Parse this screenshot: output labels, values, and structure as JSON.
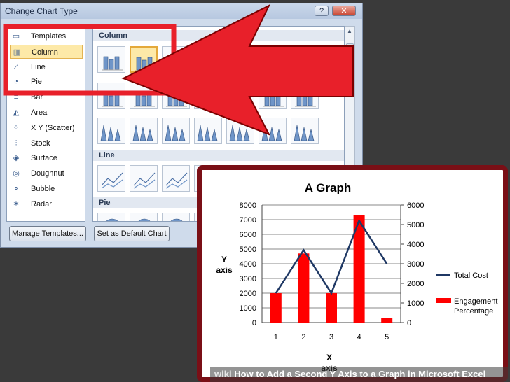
{
  "dialog": {
    "title": "Change Chart Type",
    "help_glyph": "?",
    "close_glyph": "✕",
    "categories": [
      {
        "label": "Templates",
        "icon": "folder-icon",
        "glyph": "▭"
      },
      {
        "label": "Column",
        "icon": "column-chart-icon",
        "glyph": "▥",
        "selected": true
      },
      {
        "label": "Line",
        "icon": "line-chart-icon",
        "glyph": "⟋"
      },
      {
        "label": "Pie",
        "icon": "pie-chart-icon",
        "glyph": "◔"
      },
      {
        "label": "Bar",
        "icon": "bar-chart-icon",
        "glyph": "≡"
      },
      {
        "label": "Area",
        "icon": "area-chart-icon",
        "glyph": "◭"
      },
      {
        "label": "X Y (Scatter)",
        "icon": "scatter-chart-icon",
        "glyph": "⁘"
      },
      {
        "label": "Stock",
        "icon": "stock-chart-icon",
        "glyph": "⫶"
      },
      {
        "label": "Surface",
        "icon": "surface-chart-icon",
        "glyph": "◈"
      },
      {
        "label": "Doughnut",
        "icon": "doughnut-chart-icon",
        "glyph": "◎"
      },
      {
        "label": "Bubble",
        "icon": "bubble-chart-icon",
        "glyph": "⚬"
      },
      {
        "label": "Radar",
        "icon": "radar-chart-icon",
        "glyph": "✶"
      }
    ],
    "sections": {
      "column": "Column",
      "line": "Line",
      "pie": "Pie"
    },
    "manage_templates_button": "Manage Templates...",
    "set_default_button": "Set as Default Chart"
  },
  "chart_data": {
    "type": "bar",
    "title": "A Graph",
    "xlabel": "X\naxis",
    "ylabel": "Y\naxis",
    "categories": [
      "1",
      "2",
      "3",
      "4",
      "5"
    ],
    "y_ticks": [
      "0",
      "1000",
      "2000",
      "3000",
      "4000",
      "5000",
      "6000",
      "7000",
      "8000"
    ],
    "y2_ticks": [
      "0",
      "1000",
      "2000",
      "3000",
      "4000",
      "5000",
      "6000"
    ],
    "ylim": [
      0,
      8000
    ],
    "y2lim": [
      0,
      6000
    ],
    "grid": true,
    "legend_placement": "right",
    "series": [
      {
        "name": "Engagement Percentage",
        "kind": "bar",
        "axis": "left",
        "color": "#ff0000",
        "values": [
          2000,
          4700,
          2000,
          7300,
          300
        ]
      },
      {
        "name": "Total Cost",
        "kind": "line",
        "axis": "right",
        "color": "#1f3864",
        "values": [
          1500,
          3700,
          1500,
          5200,
          3000
        ]
      }
    ]
  },
  "caption": {
    "prefix": "wiki",
    "text": "How to Add a Second Y Axis to a Graph in Microsoft Excel"
  },
  "annotation": {
    "arrow_color": "#e8202a"
  }
}
